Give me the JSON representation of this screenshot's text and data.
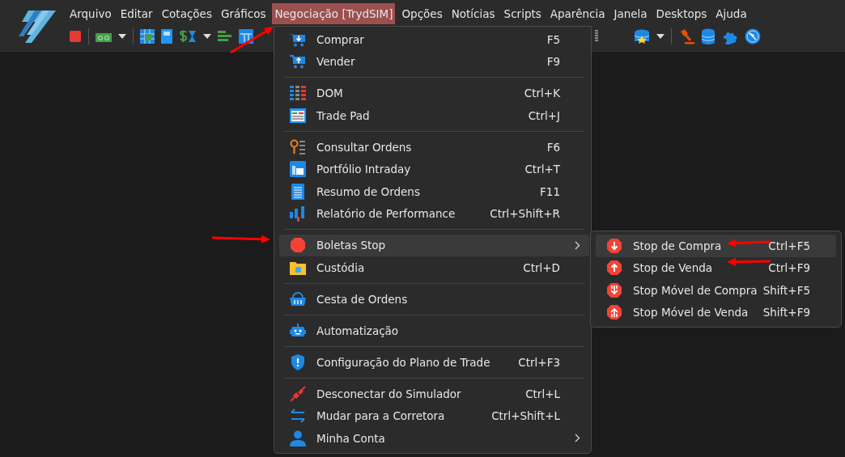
{
  "menubar": [
    {
      "label": "Arquivo",
      "selected": false
    },
    {
      "label": "Editar",
      "selected": false
    },
    {
      "label": "Cotações",
      "selected": false
    },
    {
      "label": "Gráficos",
      "selected": false
    },
    {
      "label": "Negociação [TrydSIM]",
      "selected": true
    },
    {
      "label": "Opções",
      "selected": false
    },
    {
      "label": "Notícias",
      "selected": false
    },
    {
      "label": "Scripts",
      "selected": false
    },
    {
      "label": "Aparência",
      "selected": false
    },
    {
      "label": "Janela",
      "selected": false
    },
    {
      "label": "Desktops",
      "selected": false
    },
    {
      "label": "Ajuda",
      "selected": false
    }
  ],
  "menu": {
    "groups": [
      [
        {
          "label": "Comprar",
          "shortcut": "F5",
          "submenu": false,
          "selected": false
        },
        {
          "label": "Vender",
          "shortcut": "F9",
          "submenu": false,
          "selected": false
        }
      ],
      [
        {
          "label": "DOM",
          "shortcut": "Ctrl+K",
          "submenu": false,
          "selected": false
        },
        {
          "label": "Trade Pad",
          "shortcut": "Ctrl+J",
          "submenu": false,
          "selected": false
        }
      ],
      [
        {
          "label": "Consultar Ordens",
          "shortcut": "F6",
          "submenu": false,
          "selected": false
        },
        {
          "label": "Portfólio Intraday",
          "shortcut": "Ctrl+T",
          "submenu": false,
          "selected": false
        },
        {
          "label": "Resumo de Ordens",
          "shortcut": "F11",
          "submenu": false,
          "selected": false
        },
        {
          "label": "Relatório de Performance",
          "shortcut": "Ctrl+Shift+R",
          "submenu": false,
          "selected": false
        }
      ],
      [
        {
          "label": "Boletas Stop",
          "submenu": true,
          "selected": true
        },
        {
          "label": "Custódia",
          "shortcut": "Ctrl+D",
          "submenu": false,
          "selected": false
        }
      ],
      [
        {
          "label": "Cesta de Ordens",
          "submenu": false,
          "selected": false
        }
      ],
      [
        {
          "label": "Automatização",
          "submenu": false,
          "selected": false
        }
      ],
      [
        {
          "label": "Configuração do Plano de Trade",
          "shortcut": "Ctrl+F3",
          "submenu": false,
          "selected": false
        }
      ],
      [
        {
          "label": "Desconectar do Simulador",
          "shortcut": "Ctrl+L",
          "submenu": false,
          "selected": false
        },
        {
          "label": "Mudar para a Corretora",
          "shortcut": "Ctrl+Shift+L",
          "submenu": false,
          "selected": false
        },
        {
          "label": "Minha Conta",
          "submenu": true,
          "selected": false
        }
      ]
    ]
  },
  "submenu": {
    "items": [
      {
        "label": "Stop de Compra",
        "shortcut": "Ctrl+F5",
        "selected": true
      },
      {
        "label": "Stop de Venda",
        "shortcut": "Ctrl+F9",
        "selected": false
      },
      {
        "label": "Stop Móvel de Compra",
        "shortcut": "Shift+F5",
        "selected": false
      },
      {
        "label": "Stop Móvel de Venda",
        "shortcut": "Shift+F9",
        "selected": false
      }
    ]
  }
}
